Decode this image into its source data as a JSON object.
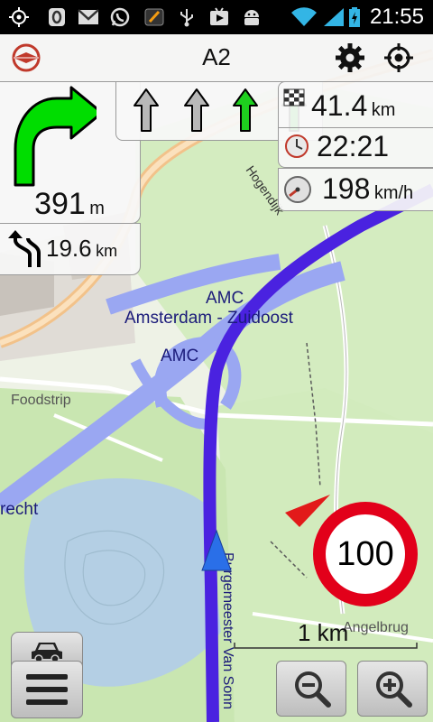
{
  "status_bar": {
    "time": "21:55",
    "icons": [
      "gps-icon",
      "notification-icon",
      "gmail-icon",
      "whatsapp-icon",
      "app-icon",
      "usb-icon",
      "play-store-icon",
      "android-icon",
      "wifi-icon",
      "signal-icon",
      "battery-icon"
    ]
  },
  "header": {
    "road_name": "A2",
    "icons": [
      "compass-icon",
      "settings-gear-icon",
      "my-location-icon"
    ]
  },
  "next_turn": {
    "distance_value": "391",
    "distance_unit": "m"
  },
  "second_turn": {
    "distance_value": "19.6",
    "distance_unit": "km"
  },
  "lanes": [
    {
      "state": "inactive"
    },
    {
      "state": "inactive"
    },
    {
      "state": "active"
    },
    {
      "state": "active"
    }
  ],
  "trip_info": {
    "remaining_distance_value": "41.4",
    "remaining_distance_unit": "km",
    "arrival_time": "22:21",
    "speed_value": "198",
    "speed_unit": "km/h"
  },
  "speed_limit": "100",
  "map_labels": {
    "amc_1": "AMC",
    "district": "Amsterdam - Zuidoost",
    "amc_2": "AMC",
    "hogendijk": "Hogendijk",
    "foodstrip": "Foodstrip",
    "recht": "recht",
    "street_vertical": "Burgemeester Van Sonn",
    "angelbrug": "Angelbrug"
  },
  "scale": {
    "label": "1 km"
  },
  "colors": {
    "route": "#4a22e0",
    "turn_arrow": "#00dd00",
    "lane_active": "#1ed01e",
    "lane_inactive": "#b8b8b8",
    "speed_sign_border": "#e2001a",
    "highway": "#9aa7f2"
  }
}
